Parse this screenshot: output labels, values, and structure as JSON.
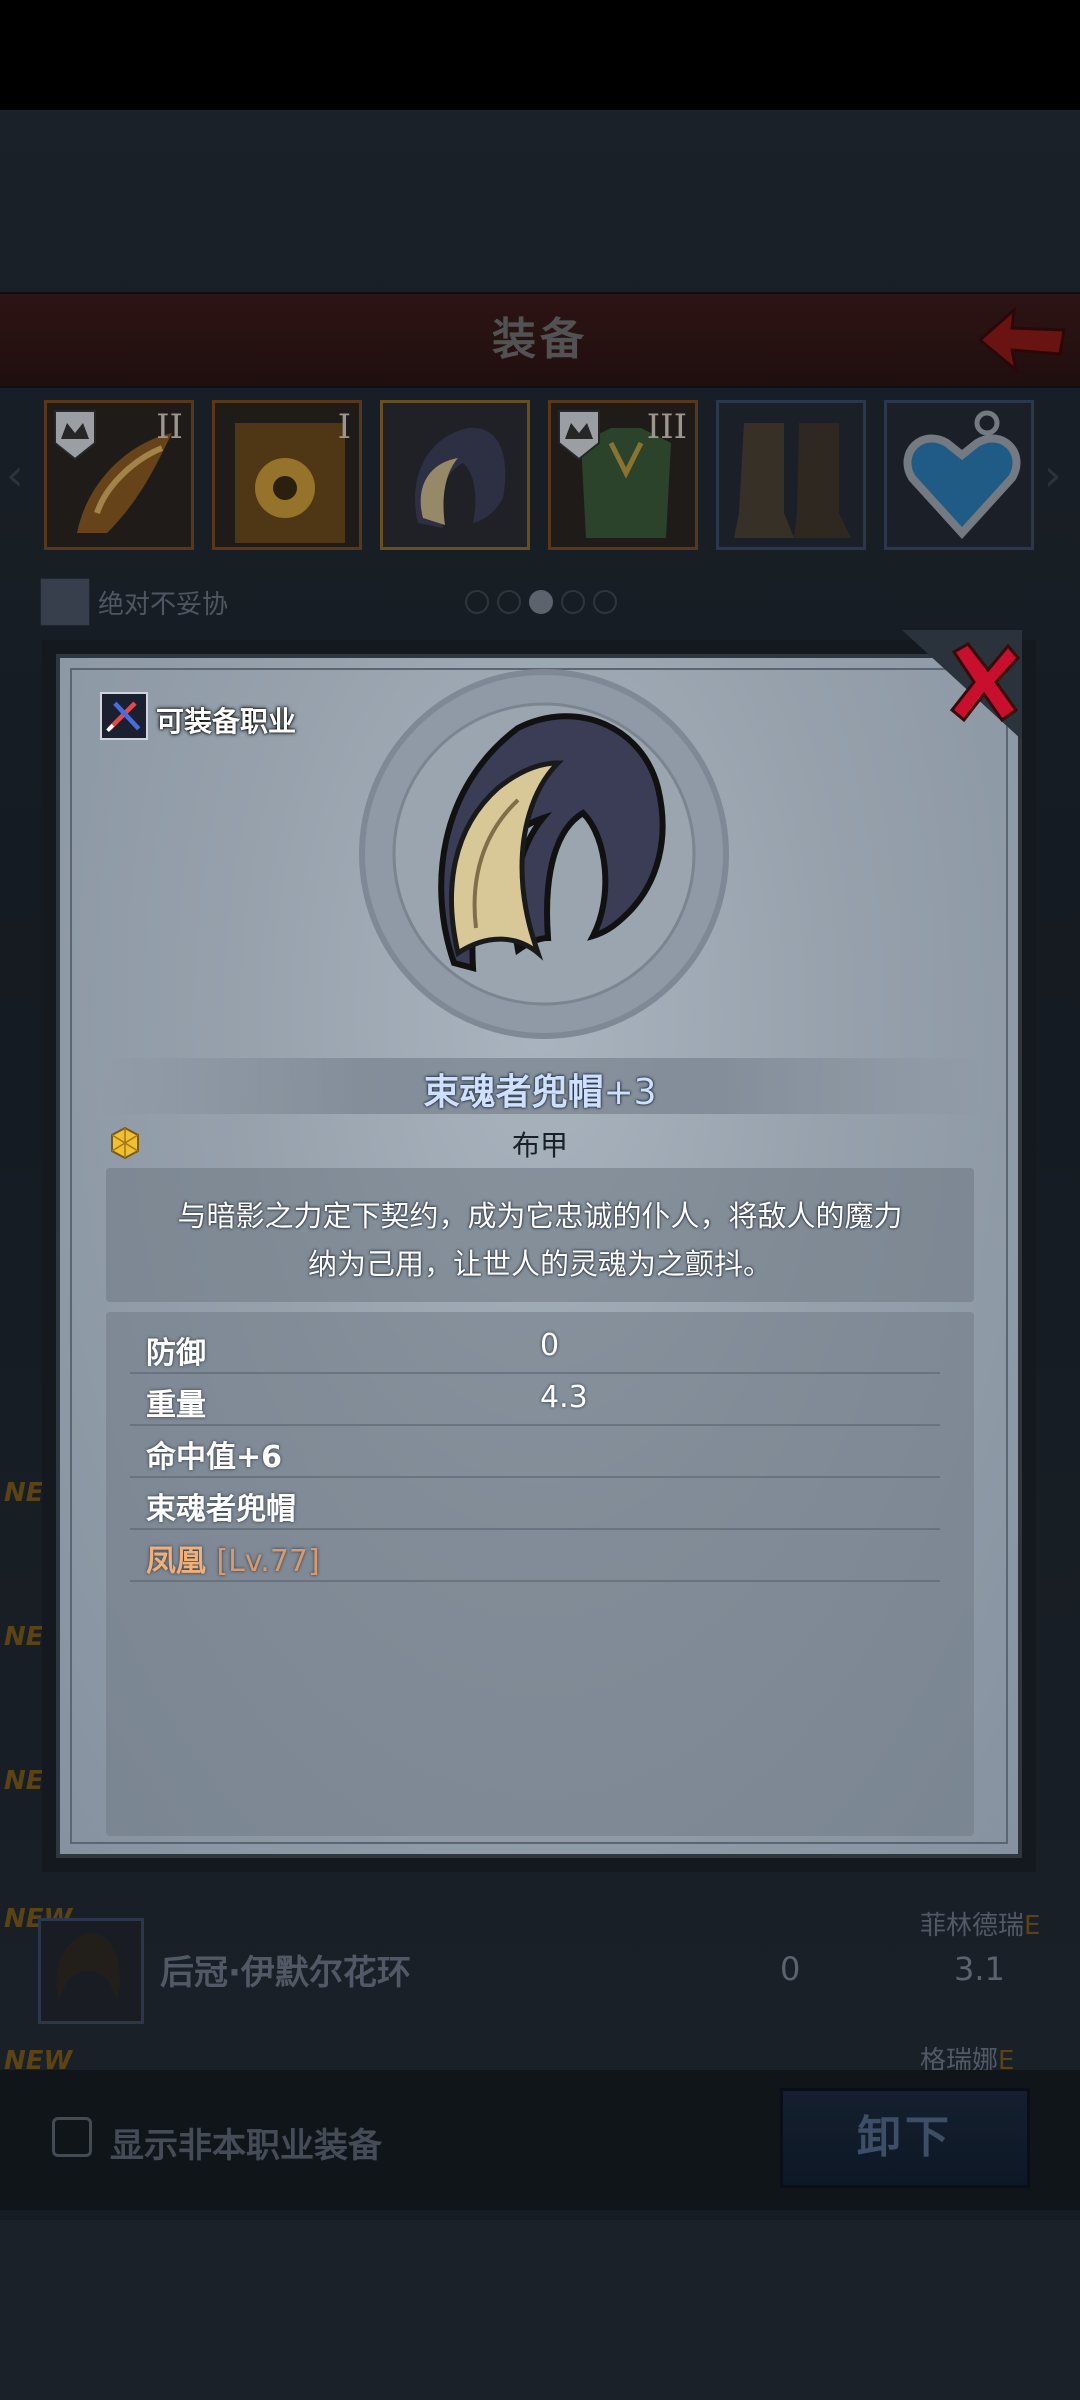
{
  "header": {
    "title": "装备"
  },
  "equip_slots": [
    {
      "rank": "II",
      "icon": "weapon-icon"
    },
    {
      "rank": "I",
      "icon": "offhand-icon"
    },
    {
      "rank": "",
      "icon": "hood-icon"
    },
    {
      "rank": "III",
      "icon": "armor-icon"
    },
    {
      "rank": "",
      "icon": "boots-icon"
    },
    {
      "rank": "",
      "icon": "amulet-icon"
    }
  ],
  "owner": {
    "name": "绝对不妥协"
  },
  "pager": {
    "total": 5,
    "active_index": 2
  },
  "background_list": {
    "new_tag": "NEW",
    "item_name": "后冠·伊默尔花环",
    "value1": "0",
    "value2": "3.1",
    "owner": "菲林德瑞",
    "owner_marker": "E",
    "owner2": "格瑞娜",
    "owner2_marker": "E"
  },
  "bottom": {
    "checkbox_label": "显示非本职业装备",
    "unequip_label": "卸下"
  },
  "modal": {
    "job_label": "可装备职业",
    "item_name": "束魂者兜帽",
    "item_plus": "+3",
    "item_type": "布甲",
    "description_line1": "与暗影之力定下契约，成为它忠诚的仆人，将敌人的魔力",
    "description_line2": "纳为己用，让世人的灵魂为之颤抖。",
    "stats": [
      {
        "label": "防御",
        "value": "0"
      },
      {
        "label": "重量",
        "value": "4.3"
      },
      {
        "label": "命中值+6",
        "value": ""
      },
      {
        "label": "束魂者兜帽",
        "value": ""
      }
    ],
    "set_row": {
      "name": "凤凰",
      "level": "[Lv.77]"
    }
  },
  "colors": {
    "header_bg": "#3e1b1b",
    "item_name": "#cfe0ff",
    "set_name": "#f0b078",
    "close_x": "#c8102e"
  }
}
